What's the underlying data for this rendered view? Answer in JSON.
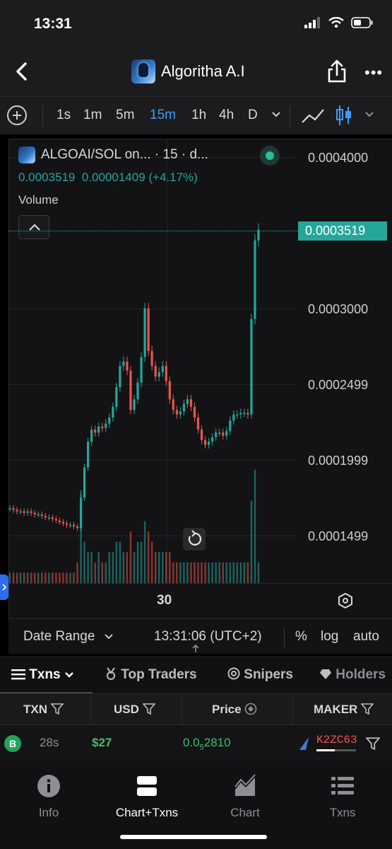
{
  "status_bar": {
    "time": "13:31"
  },
  "header": {
    "title": "Algoritha A.I"
  },
  "timeframes": [
    {
      "label": "1s",
      "active": false
    },
    {
      "label": "1m",
      "active": false
    },
    {
      "label": "5m",
      "active": false
    },
    {
      "label": "15m",
      "active": true
    },
    {
      "label": "1h",
      "active": false
    },
    {
      "label": "4h",
      "active": false
    },
    {
      "label": "D",
      "active": false
    }
  ],
  "chart_header": {
    "pair": "ALGOAI/SOL on... · 15 · d...",
    "open": "0.0003519",
    "change": "0.00001409 (+4.17%)",
    "volume_label": "Volume"
  },
  "chart_data": {
    "type": "candlestick",
    "interval": "15m",
    "y_ticks": [
      "0.0004000",
      "0.0003000",
      "0.0002499",
      "0.0001999",
      "0.0001499"
    ],
    "last_price": "0.0003519",
    "x_ticks": [
      "30"
    ],
    "ylim": [
      0.00012,
      0.00041
    ],
    "up_color": "#26a69a",
    "down_color": "#ef5350",
    "close_series": [
      0.000168,
      0.000167,
      0.000166,
      0.000166,
      0.000165,
      0.000166,
      0.000165,
      0.000164,
      0.000164,
      0.000163,
      0.000162,
      0.000162,
      0.000161,
      0.00016,
      0.000159,
      0.000158,
      0.000157,
      0.000157,
      0.000156,
      0.000155,
      0.000175,
      0.000195,
      0.000212,
      0.00022,
      0.000218,
      0.000222,
      0.000221,
      0.000224,
      0.000228,
      0.000235,
      0.000248,
      0.000262,
      0.000265,
      0.000259,
      0.000233,
      0.00024,
      0.000251,
      0.000268,
      0.0003,
      0.000272,
      0.000262,
      0.000255,
      0.000258,
      0.000262,
      0.000252,
      0.00024,
      0.000233,
      0.00023,
      0.000232,
      0.000237,
      0.00024,
      0.000235,
      0.000228,
      0.00022,
      0.000213,
      0.00021,
      0.000212,
      0.000215,
      0.000218,
      0.000218,
      0.000216,
      0.000219,
      0.000226,
      0.00023,
      0.00023,
      0.000231,
      0.000231,
      0.00023,
      0.000293,
      0.000345,
      0.000352
    ],
    "volume_series": [
      1,
      1,
      1,
      1,
      1,
      1,
      1,
      1,
      1,
      1,
      1,
      1,
      1,
      1,
      1,
      1,
      1,
      1,
      1,
      2,
      9,
      4,
      3,
      3,
      2,
      3,
      2,
      2,
      3,
      3,
      4,
      4,
      3,
      3,
      5,
      3,
      4,
      4,
      6,
      5,
      4,
      3,
      3,
      3,
      3,
      3,
      2,
      2,
      2,
      2,
      2,
      2,
      2,
      2,
      2,
      2,
      2,
      2,
      2,
      2,
      2,
      2,
      2,
      2,
      2,
      2,
      2,
      2,
      8,
      11,
      2
    ]
  },
  "range_bar": {
    "date_range": "Date Range",
    "clock": "13:31:06 (UTC+2)",
    "percent": "%",
    "log": "log",
    "auto": "auto"
  },
  "tabs": [
    {
      "label": "Txns",
      "active": true
    },
    {
      "label": "Top Traders",
      "active": false
    },
    {
      "label": "Snipers",
      "active": false
    },
    {
      "label": "Holders",
      "active": false
    }
  ],
  "table": {
    "columns": [
      "TXN",
      "USD",
      "Price",
      "MAKER"
    ],
    "rows": [
      {
        "type": "B",
        "age": "28s",
        "usd": "$27",
        "price_main": "0.0",
        "price_sub": "5",
        "price_tail": "2810",
        "maker": "K2ZC63"
      }
    ]
  },
  "bottom_nav": [
    {
      "label": "Info",
      "active": false
    },
    {
      "label": "Chart+Txns",
      "active": true
    },
    {
      "label": "Chart",
      "active": false
    },
    {
      "label": "Txns",
      "active": false
    }
  ],
  "colors": {
    "accent": "#3d9bff",
    "up": "#26a69a",
    "down": "#ef5350",
    "buy_badge": "#22a45a"
  }
}
